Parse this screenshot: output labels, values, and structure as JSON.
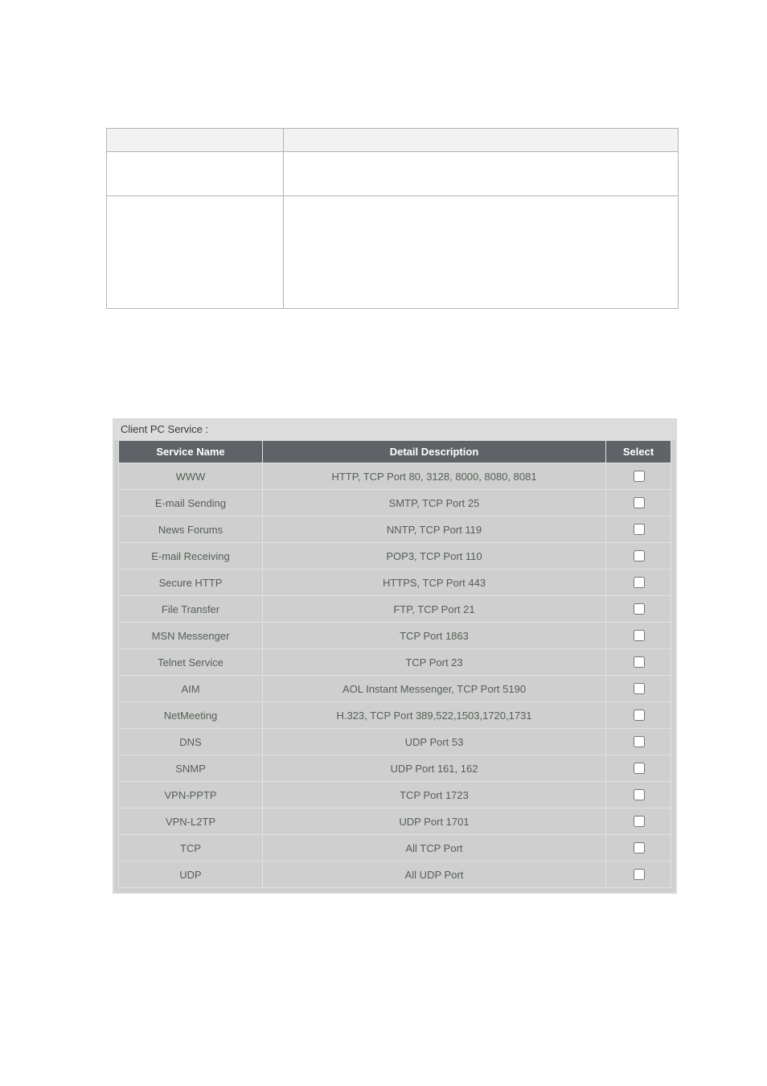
{
  "upper_table": {
    "purpose": "empty two-column table template (no visible text)"
  },
  "service_block": {
    "legend": "Client PC Service :",
    "headers": {
      "name": "Service Name",
      "desc": "Detail Description",
      "select": "Select"
    },
    "rows": [
      {
        "name": "WWW",
        "desc": "HTTP, TCP Port 80, 3128, 8000, 8080, 8081",
        "checked": false
      },
      {
        "name": "E-mail Sending",
        "desc": "SMTP, TCP Port 25",
        "checked": false
      },
      {
        "name": "News Forums",
        "desc": "NNTP, TCP Port 119",
        "checked": false
      },
      {
        "name": "E-mail Receiving",
        "desc": "POP3, TCP Port 110",
        "checked": false
      },
      {
        "name": "Secure HTTP",
        "desc": "HTTPS, TCP Port 443",
        "checked": false
      },
      {
        "name": "File Transfer",
        "desc": "FTP, TCP Port 21",
        "checked": false
      },
      {
        "name": "MSN Messenger",
        "desc": "TCP Port 1863",
        "checked": false
      },
      {
        "name": "Telnet Service",
        "desc": "TCP Port 23",
        "checked": false
      },
      {
        "name": "AIM",
        "desc": "AOL Instant Messenger, TCP Port 5190",
        "checked": false
      },
      {
        "name": "NetMeeting",
        "desc": "H.323, TCP Port 389,522,1503,1720,1731",
        "checked": false
      },
      {
        "name": "DNS",
        "desc": "UDP Port 53",
        "checked": false
      },
      {
        "name": "SNMP",
        "desc": "UDP Port 161, 162",
        "checked": false
      },
      {
        "name": "VPN-PPTP",
        "desc": "TCP Port 1723",
        "checked": false
      },
      {
        "name": "VPN-L2TP",
        "desc": "UDP Port 1701",
        "checked": false
      },
      {
        "name": "TCP",
        "desc": "All TCP Port",
        "checked": false
      },
      {
        "name": "UDP",
        "desc": "All UDP Port",
        "checked": false
      }
    ]
  }
}
